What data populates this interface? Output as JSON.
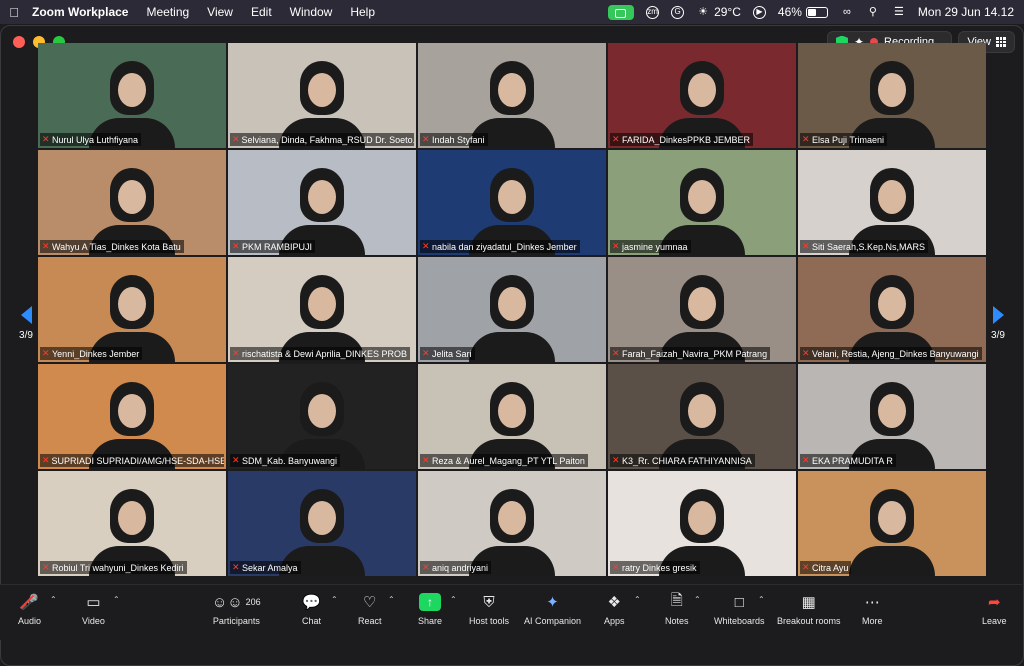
{
  "menubar": {
    "app_name": "Zoom Workplace",
    "menus": [
      "Meeting",
      "View",
      "Edit",
      "Window",
      "Help"
    ],
    "temperature": "29°C",
    "battery": "46%",
    "datetime": "Mon 29 Jun  14.12",
    "status_icons": [
      "camera-sharing-icon",
      "zoom-status-icon",
      "grammarly-icon",
      "weather-sun-icon",
      "play-icon",
      "battery-icon",
      "screen-mirror-icon",
      "search-icon",
      "control-center-icon"
    ]
  },
  "window": {
    "recording_label": "Recording...",
    "view_label": "View"
  },
  "pager": {
    "left_label": "3/9",
    "right_label": "3/9"
  },
  "participants": [
    {
      "name": "Nurul Ulya Luthfiyana",
      "muted": true,
      "bg": "#4a6b55"
    },
    {
      "name": "Selviana, Dinda, Fakhma_RSUD Dr. Soeto...",
      "muted": true,
      "bg": "#c9c2b9"
    },
    {
      "name": "Indah Styfani",
      "muted": true,
      "bg": "#a7a39c"
    },
    {
      "name": "FARIDA_DinkesPPKB JEMBER",
      "muted": true,
      "bg": "#7a2a2e"
    },
    {
      "name": "Elsa Puji Trimaeni",
      "muted": true,
      "bg": "#6b5a47"
    },
    {
      "name": "Wahyu A Tias_Dinkes Kota Batu",
      "muted": true,
      "bg": "#b98c6a"
    },
    {
      "name": "PKM RAMBIPUJI",
      "muted": true,
      "bg": "#b8bcc4"
    },
    {
      "name": "nabila dan ziyadatul_Dinkes Jember",
      "muted": true,
      "bg": "#1f3b73"
    },
    {
      "name": "jasmine yumnaa",
      "muted": true,
      "bg": "#8a9f7a"
    },
    {
      "name": "Siti Saerah,S.Kep.Ns,MARS",
      "muted": true,
      "bg": "#d6d1cc"
    },
    {
      "name": "Yenni_Dinkes Jember",
      "muted": true,
      "bg": "#c88a55"
    },
    {
      "name": "rischatista & Dewi Aprilia_DINKES PROB",
      "muted": true,
      "bg": "#d4ccc0"
    },
    {
      "name": "Jelita Sari",
      "muted": true,
      "bg": "#9fa3a8"
    },
    {
      "name": "Farah_Faizah_Navira_PKM Patrang",
      "muted": true,
      "bg": "#9a8f86"
    },
    {
      "name": "Velani, Restia, Ajeng_Dinkes Banyuwangi",
      "muted": true,
      "bg": "#8f6a55"
    },
    {
      "name": "SUPRIADI SUPRIADI/AMG/HSE-SDA-HSE...",
      "muted": true,
      "bg": "#d18a4e"
    },
    {
      "name": "SDM_Kab. Banyuwangi",
      "muted": true,
      "bg": "#222222"
    },
    {
      "name": "Reza & Aurel_Magang_PT YTL Paiton",
      "muted": true,
      "bg": "#c7c2b5"
    },
    {
      "name": "K3_Rr. CHIARA FATHIYANNISA",
      "muted": true,
      "bg": "#5a5048"
    },
    {
      "name": "EKA PRAMUDITA R",
      "muted": true,
      "bg": "#b9b6b3"
    },
    {
      "name": "Robiul Tri wahyuni_Dinkes Kediri",
      "muted": true,
      "bg": "#d9cfc0"
    },
    {
      "name": "Sekar Amalya",
      "muted": true,
      "bg": "#2a3a66"
    },
    {
      "name": "aniq andriyani",
      "muted": true,
      "bg": "#cfcac4"
    },
    {
      "name": "ratry Dinkes gresik",
      "muted": true,
      "bg": "#e8e2de"
    },
    {
      "name": "Citra Ayu",
      "muted": true,
      "bg": "#c9925c"
    }
  ],
  "toolbar": {
    "audio": "Audio",
    "video": "Video",
    "participants": "Participants",
    "participants_count": "206",
    "chat": "Chat",
    "react": "React",
    "share": "Share",
    "host_tools": "Host tools",
    "ai_companion": "AI Companion",
    "apps": "Apps",
    "notes": "Notes",
    "whiteboards": "Whiteboards",
    "breakout_rooms": "Breakout rooms",
    "more": "More",
    "leave": "Leave"
  },
  "colors": {
    "accent_blue": "#2d8cff",
    "share_green": "#1ed760",
    "mute_red": "#ff3b30",
    "leave_red": "#ff453a"
  }
}
